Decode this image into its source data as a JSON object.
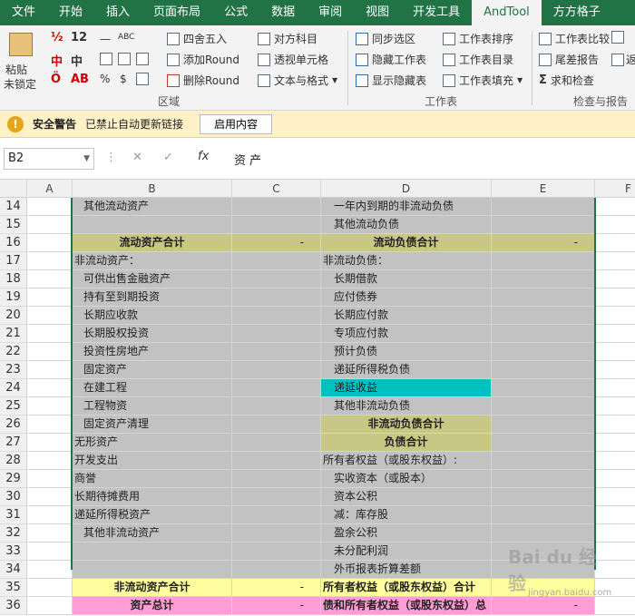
{
  "tabs": [
    "文件",
    "开始",
    "插入",
    "页面布局",
    "公式",
    "数据",
    "审阅",
    "视图",
    "开发工具",
    "AndTool",
    "方方格子"
  ],
  "ribbon": {
    "paste": "粘贴",
    "unlock": "未锁定",
    "num12": "12",
    "zhong": "中",
    "ab": "AB",
    "pct": "%",
    "dollar": "$",
    "round": "四舍五入",
    "add_round": "添加Round",
    "del_round": "删除Round",
    "compare": "对方科目",
    "pivot_cell": "透视单元格",
    "text_format": "文本与格式",
    "sync_sel": "同步选区",
    "hide_sheet": "隐藏工作表",
    "show_hidden": "显示隐藏表",
    "sheet_sort": "工作表排序",
    "sheet_dir": "工作表目录",
    "sheet_fill": "工作表填充",
    "sheet_cmp": "工作表比较",
    "diff_report": "尾差报告",
    "sum_check": "求和检查",
    "ret": "返",
    "grp_area": "区域",
    "grp_sheet": "工作表",
    "grp_check": "检查与报告"
  },
  "msg": {
    "title": "安全警告",
    "text": "已禁止自动更新链接",
    "button": "启用内容"
  },
  "formula": {
    "namebox": "B2",
    "fx": "fx",
    "value": "资产"
  },
  "columns": [
    "A",
    "B",
    "C",
    "D",
    "E",
    "F"
  ],
  "rows": [
    {
      "n": "14",
      "b": "其他流动资产",
      "c": "",
      "d": "一年内到期的非流动负债",
      "e": ""
    },
    {
      "n": "15",
      "b": "",
      "c": "",
      "d": "其他流动负债",
      "e": ""
    },
    {
      "n": "16",
      "b": "流动资产合计",
      "c": "-",
      "d": "流动负债合计",
      "e": "-"
    },
    {
      "n": "17",
      "b": "非流动资产：",
      "c": "",
      "d": "非流动负债：",
      "e": ""
    },
    {
      "n": "18",
      "b": "可供出售金融资产",
      "c": "",
      "d": "长期借款",
      "e": ""
    },
    {
      "n": "19",
      "b": "持有至到期投资",
      "c": "",
      "d": "应付债券",
      "e": ""
    },
    {
      "n": "20",
      "b": "长期应收款",
      "c": "",
      "d": "长期应付款",
      "e": ""
    },
    {
      "n": "21",
      "b": "长期股权投资",
      "c": "",
      "d": "专项应付款",
      "e": ""
    },
    {
      "n": "22",
      "b": "投资性房地产",
      "c": "",
      "d": "预计负债",
      "e": ""
    },
    {
      "n": "23",
      "b": "固定资产",
      "c": "",
      "d": "递延所得税负债",
      "e": ""
    },
    {
      "n": "24",
      "b": "在建工程",
      "c": "",
      "d": "递延收益",
      "e": ""
    },
    {
      "n": "25",
      "b": "工程物资",
      "c": "",
      "d": "其他非流动负债",
      "e": ""
    },
    {
      "n": "26",
      "b": "固定资产清理",
      "c": "",
      "d": "非流动负债合计",
      "e": ""
    },
    {
      "n": "27",
      "b": "无形资产",
      "c": "",
      "d": "负债合计",
      "e": ""
    },
    {
      "n": "28",
      "b": "开发支出",
      "c": "",
      "d": "所有者权益（或股东权益）:",
      "e": ""
    },
    {
      "n": "29",
      "b": "商誉",
      "c": "",
      "d": "实收资本（或股本）",
      "e": ""
    },
    {
      "n": "30",
      "b": "长期待摊费用",
      "c": "",
      "d": "资本公积",
      "e": ""
    },
    {
      "n": "31",
      "b": "递延所得税资产",
      "c": "",
      "d": "减：库存股",
      "e": ""
    },
    {
      "n": "32",
      "b": "其他非流动资产",
      "c": "",
      "d": "盈余公积",
      "e": ""
    },
    {
      "n": "33",
      "b": "",
      "c": "",
      "d": "未分配利润",
      "e": ""
    },
    {
      "n": "34",
      "b": "",
      "c": "",
      "d": "外币报表折算差额",
      "e": ""
    },
    {
      "n": "35",
      "b": "非流动资产合计",
      "c": "-",
      "d": "所有者权益（或股东权益）合计",
      "e": ""
    },
    {
      "n": "36",
      "b": "资产总计",
      "c": "-",
      "d": "债和所有者权益（或股东权益）总",
      "e": "-"
    }
  ],
  "watermark": {
    "main": "Bai du 经验",
    "sub": "jingyan.baidu.com"
  }
}
